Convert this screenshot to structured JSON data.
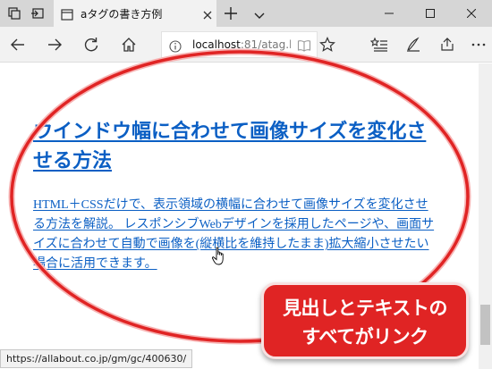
{
  "tab": {
    "title": "aタグの書き方例"
  },
  "address": {
    "host": "localhost",
    "rest": ":81/atag.htm"
  },
  "page": {
    "heading": "ウインドウ幅に合わせて画像サイズを変化させる方法",
    "paragraph": "HTML＋CSSだけで、表示領域の横幅に合わせて画像サイズを変化させる方法を解説。 レスポンシブWebデザインを採用したページや、画面サイズに合わせて自動で画像を(縦横比を維持したまま)拡大縮小させたい場合に活用できます。"
  },
  "callout": {
    "line1": "見出しとテキストの",
    "line2": "すべてがリンク"
  },
  "status": {
    "url": "https://allabout.co.jp/gm/gc/400630/"
  },
  "colors": {
    "link": "#0b5fc4",
    "annotation": "#e02424"
  },
  "icons": [
    "tab-manager-icon",
    "set-aside-tabs-icon",
    "page-icon",
    "close-icon",
    "plus-icon",
    "chevron-down-icon",
    "minimize-icon",
    "maximize-icon",
    "close-window-icon",
    "back-icon",
    "forward-icon",
    "refresh-icon",
    "home-icon",
    "info-icon",
    "reading-view-icon",
    "favorite-star-icon",
    "favorites-list-icon",
    "pen-icon",
    "share-icon",
    "more-icon",
    "hand-cursor-icon"
  ]
}
